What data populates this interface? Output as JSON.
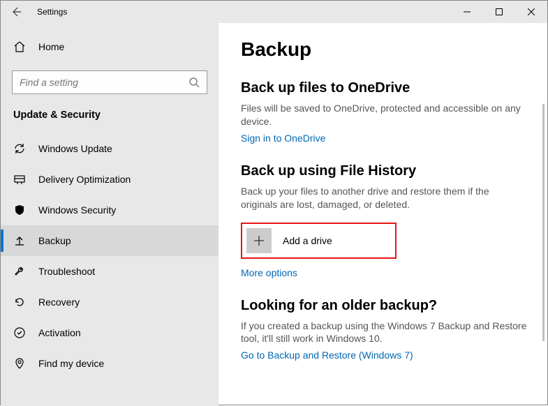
{
  "titlebar": {
    "title": "Settings"
  },
  "sidebar": {
    "home": "Home",
    "search_placeholder": "Find a setting",
    "section": "Update & Security",
    "items": [
      {
        "label": "Windows Update"
      },
      {
        "label": "Delivery Optimization"
      },
      {
        "label": "Windows Security"
      },
      {
        "label": "Backup"
      },
      {
        "label": "Troubleshoot"
      },
      {
        "label": "Recovery"
      },
      {
        "label": "Activation"
      },
      {
        "label": "Find my device"
      }
    ]
  },
  "page": {
    "title": "Backup",
    "onedrive": {
      "heading": "Back up files to OneDrive",
      "desc": "Files will be saved to OneDrive, protected and accessible on any device.",
      "link": "Sign in to OneDrive"
    },
    "filehistory": {
      "heading": "Back up using File History",
      "desc": "Back up your files to another drive and restore them if the originals are lost, damaged, or deleted.",
      "add_drive": "Add a drive",
      "more_options": "More options"
    },
    "older": {
      "heading": "Looking for an older backup?",
      "desc": "If you created a backup using the Windows 7 Backup and Restore tool, it'll still work in Windows 10.",
      "link": "Go to Backup and Restore (Windows 7)"
    }
  }
}
